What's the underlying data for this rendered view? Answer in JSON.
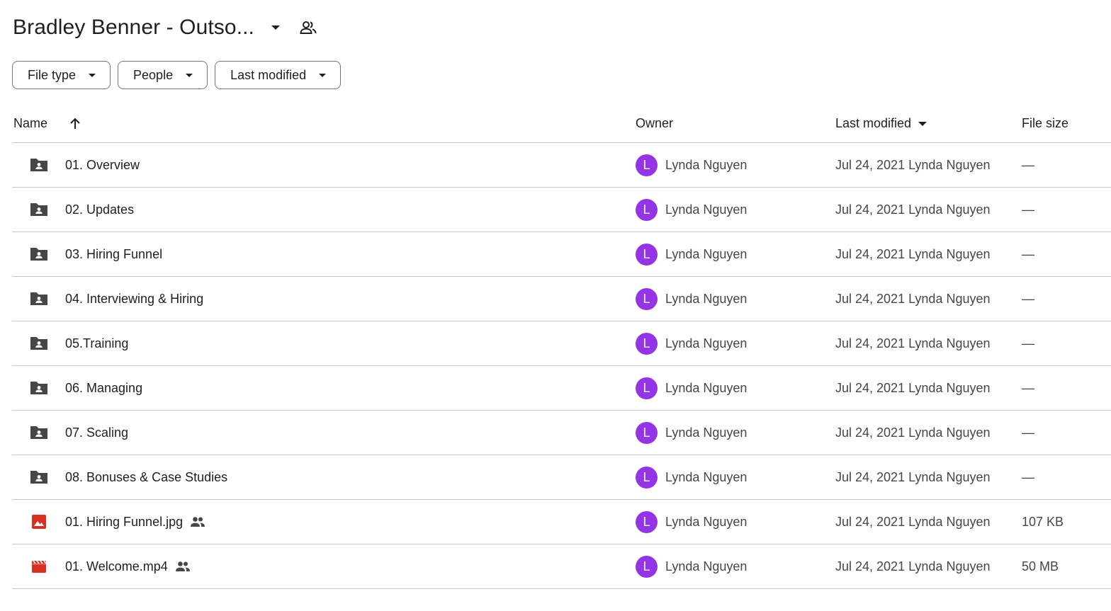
{
  "header": {
    "title": "Bradley Benner - Outso...",
    "title_caret_icon": "caret-down-icon",
    "shared_icon": "shared-people-icon"
  },
  "filters": [
    {
      "label": "File type"
    },
    {
      "label": "People"
    },
    {
      "label": "Last modified"
    }
  ],
  "columns": {
    "name": "Name",
    "owner": "Owner",
    "last_modified": "Last modified",
    "file_size": "File size",
    "name_sort_icon": "arrow-up-icon",
    "last_modified_sort_icon": "caret-down-icon"
  },
  "colors": {
    "folder_icon": "#444746",
    "file_icon_red": "#d93025",
    "avatar_bg": "#9334e6",
    "divider": "#c7c7c7"
  },
  "rows": [
    {
      "icon": "shared-folder-icon",
      "name": "01. Overview",
      "shared": false,
      "avatar": "L",
      "owner": "Lynda Nguyen",
      "modified": "Jul 24, 2021 Lynda Nguyen",
      "size": "—"
    },
    {
      "icon": "shared-folder-icon",
      "name": "02. Updates",
      "shared": false,
      "avatar": "L",
      "owner": "Lynda Nguyen",
      "modified": "Jul 24, 2021 Lynda Nguyen",
      "size": "—"
    },
    {
      "icon": "shared-folder-icon",
      "name": "03. Hiring Funnel",
      "shared": false,
      "avatar": "L",
      "owner": "Lynda Nguyen",
      "modified": "Jul 24, 2021 Lynda Nguyen",
      "size": "—"
    },
    {
      "icon": "shared-folder-icon",
      "name": "04. Interviewing & Hiring",
      "shared": false,
      "avatar": "L",
      "owner": "Lynda Nguyen",
      "modified": "Jul 24, 2021 Lynda Nguyen",
      "size": "—"
    },
    {
      "icon": "shared-folder-icon",
      "name": "05.Training",
      "shared": false,
      "avatar": "L",
      "owner": "Lynda Nguyen",
      "modified": "Jul 24, 2021 Lynda Nguyen",
      "size": "—"
    },
    {
      "icon": "shared-folder-icon",
      "name": "06. Managing",
      "shared": false,
      "avatar": "L",
      "owner": "Lynda Nguyen",
      "modified": "Jul 24, 2021 Lynda Nguyen",
      "size": "—"
    },
    {
      "icon": "shared-folder-icon",
      "name": "07. Scaling",
      "shared": false,
      "avatar": "L",
      "owner": "Lynda Nguyen",
      "modified": "Jul 24, 2021 Lynda Nguyen",
      "size": "—"
    },
    {
      "icon": "shared-folder-icon",
      "name": "08. Bonuses & Case Studies",
      "shared": false,
      "avatar": "L",
      "owner": "Lynda Nguyen",
      "modified": "Jul 24, 2021 Lynda Nguyen",
      "size": "—"
    },
    {
      "icon": "image-file-icon",
      "name": "01. Hiring Funnel.jpg",
      "shared": true,
      "avatar": "L",
      "owner": "Lynda Nguyen",
      "modified": "Jul 24, 2021 Lynda Nguyen",
      "size": "107 KB"
    },
    {
      "icon": "video-file-icon",
      "name": "01. Welcome.mp4",
      "shared": true,
      "avatar": "L",
      "owner": "Lynda Nguyen",
      "modified": "Jul 24, 2021 Lynda Nguyen",
      "size": "50 MB"
    }
  ]
}
